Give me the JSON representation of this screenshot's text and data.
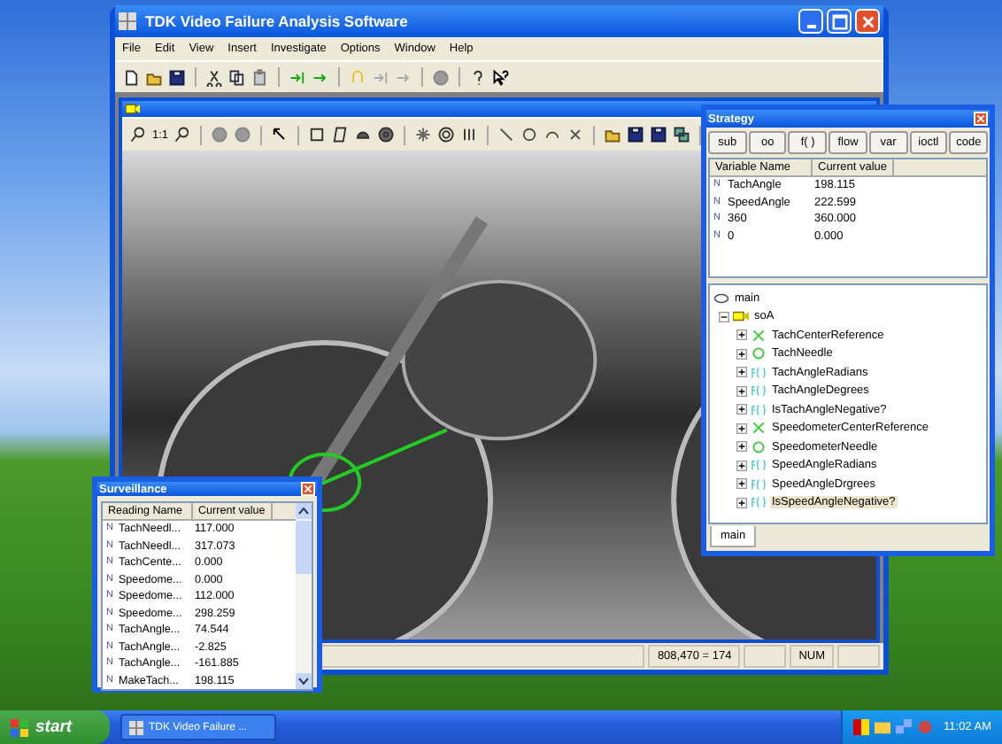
{
  "main_window": {
    "title": "TDK Video Failure Analysis Software",
    "menu": [
      "File",
      "Edit",
      "View",
      "Insert",
      "Investigate",
      "Options",
      "Window",
      "Help"
    ],
    "child_window": {
      "zoom_label": "1:1"
    },
    "status_bar": {
      "position": "808,470 = 174",
      "num": "NUM"
    }
  },
  "strategy": {
    "title": "Strategy",
    "buttons": [
      "sub",
      "oo",
      "f( )",
      "flow",
      "var",
      "ioctl",
      "code"
    ],
    "columns": [
      "Variable Name",
      "Current value"
    ],
    "rows": [
      {
        "type": "N",
        "name": "TachAngle",
        "value": "198.115"
      },
      {
        "type": "N",
        "name": "SpeedAngle",
        "value": "222.599"
      },
      {
        "type": "N",
        "name": "360",
        "value": "360.000"
      },
      {
        "type": "N",
        "name": "0",
        "value": "0.000"
      }
    ],
    "tree": {
      "label": "main",
      "selected": false,
      "children": [
        {
          "label": "soA",
          "kind": "object",
          "expanded": true,
          "selected": false,
          "children": [
            {
              "label": "TachCenterReference",
              "kind": "reference",
              "expanded": false,
              "selected": false
            },
            {
              "label": "TachNeedle",
              "kind": "needle",
              "expanded": false,
              "selected": false
            },
            {
              "label": "TachAngleRadians",
              "kind": "function",
              "expanded": false,
              "selected": false
            },
            {
              "label": "TachAngleDegrees",
              "kind": "function",
              "expanded": false,
              "selected": false
            },
            {
              "label": "IsTachAngleNegative?",
              "kind": "function",
              "expanded": false,
              "selected": false
            },
            {
              "label": "SpeedometerCenterReference",
              "kind": "reference",
              "expanded": false,
              "selected": false
            },
            {
              "label": "SpeedometerNeedle",
              "kind": "needle",
              "expanded": false,
              "selected": false
            },
            {
              "label": "SpeedAngleRadians",
              "kind": "function",
              "expanded": false,
              "selected": false
            },
            {
              "label": "SpeedAngleDrgrees",
              "kind": "function",
              "expanded": false,
              "selected": false
            },
            {
              "label": "IsSpeedAngleNegative?",
              "kind": "function",
              "expanded": false,
              "selected": true
            }
          ]
        }
      ]
    },
    "tabs": [
      {
        "label": "main",
        "selected": true
      }
    ]
  },
  "surveillance": {
    "title": "Surveillance",
    "columns": [
      "Reading Name",
      "Current value"
    ],
    "rows": [
      {
        "type": "N",
        "name": "TachNeedl...",
        "value": "117.000"
      },
      {
        "type": "N",
        "name": "TachNeedl...",
        "value": "317.073"
      },
      {
        "type": "N",
        "name": "TachCente...",
        "value": "0.000"
      },
      {
        "type": "N",
        "name": "Speedome...",
        "value": "0.000"
      },
      {
        "type": "N",
        "name": "Speedome...",
        "value": "112.000"
      },
      {
        "type": "N",
        "name": "Speedome...",
        "value": "298.259"
      },
      {
        "type": "N",
        "name": "TachAngle...",
        "value": "74.544"
      },
      {
        "type": "N",
        "name": "TachAngle...",
        "value": "-2.825"
      },
      {
        "type": "N",
        "name": "TachAngle...",
        "value": "-161.885"
      },
      {
        "type": "N",
        "name": "MakeTach...",
        "value": "198.115"
      }
    ]
  },
  "taskbar": {
    "start": "start",
    "tasks": [
      "TDK Video Failure ..."
    ],
    "clock": "11:02 AM"
  }
}
